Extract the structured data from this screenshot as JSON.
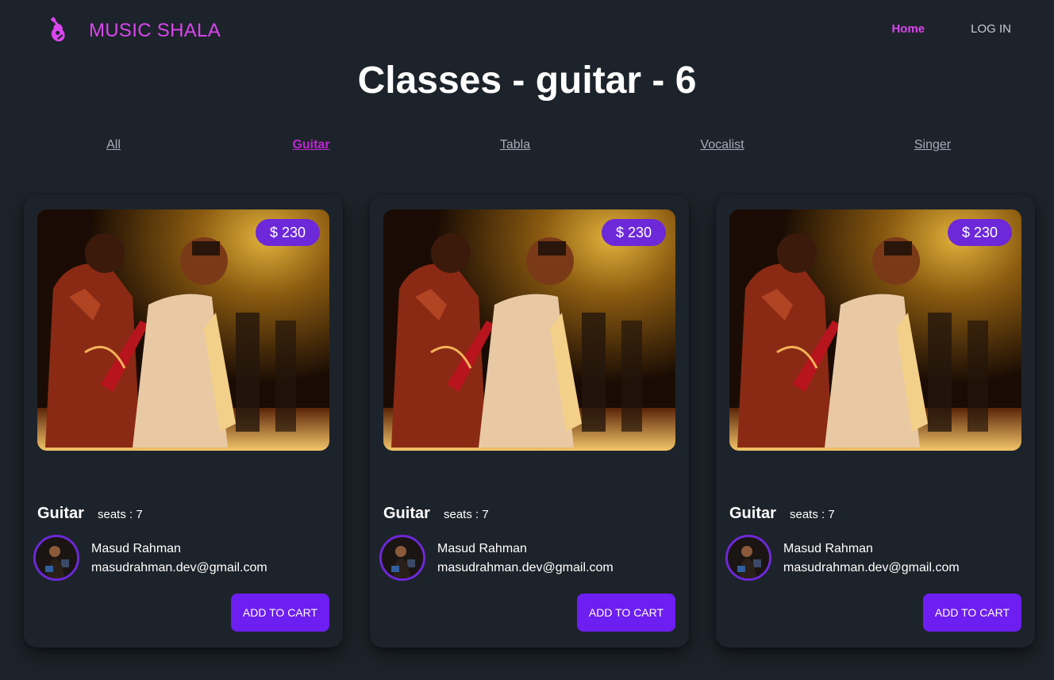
{
  "navbar": {
    "brand_name": "MUSIC SHALA",
    "brand_icon": "guitar-icon",
    "links": [
      {
        "label": "Home",
        "active": true
      },
      {
        "label": "LOG IN",
        "active": false
      }
    ]
  },
  "page": {
    "title": "Classes - guitar - 6"
  },
  "filters": [
    {
      "label": "All",
      "active": false
    },
    {
      "label": "Guitar",
      "active": true
    },
    {
      "label": "Tabla",
      "active": false
    },
    {
      "label": "Vocalist",
      "active": false
    },
    {
      "label": "Singer",
      "active": false
    }
  ],
  "cards": [
    {
      "price": "$ 230",
      "title": "Guitar",
      "seats": "seats : 7",
      "instructor_name": "Masud Rahman",
      "instructor_email": "masudrahman.dev@gmail.com",
      "button_label": "ADD TO CART"
    },
    {
      "price": "$ 230",
      "title": "Guitar",
      "seats": "seats : 7",
      "instructor_name": "Masud Rahman",
      "instructor_email": "masudrahman.dev@gmail.com",
      "button_label": "ADD TO CART"
    },
    {
      "price": "$ 230",
      "title": "Guitar",
      "seats": "seats : 7",
      "instructor_name": "Masud Rahman",
      "instructor_email": "masudrahman.dev@gmail.com",
      "button_label": "ADD TO CART"
    }
  ],
  "colors": {
    "background": "#1d232a",
    "accent": "#d946ef",
    "primary_button": "#6d1ef0",
    "badge": "#6d28d9"
  }
}
